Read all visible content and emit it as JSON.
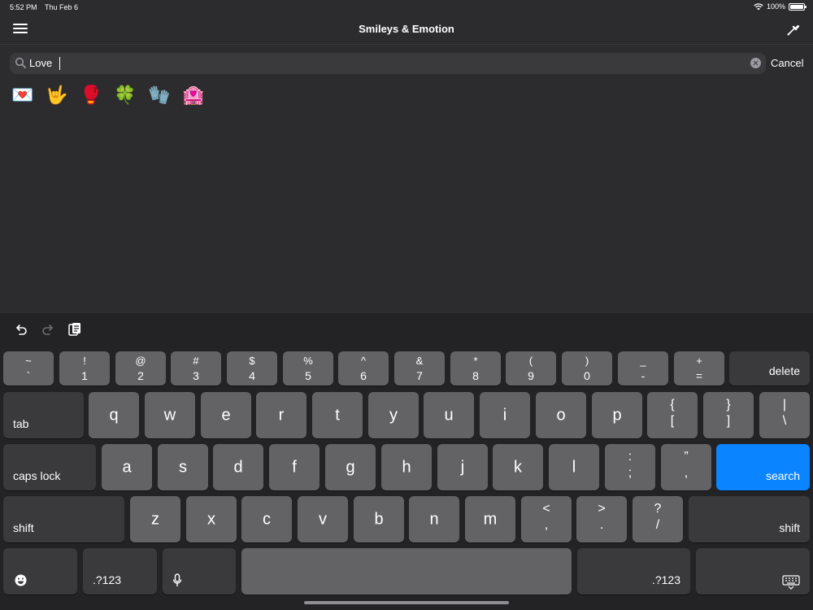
{
  "status": {
    "time": "5:52 PM",
    "date": "Thu Feb 6",
    "battery": "100%",
    "battery_level": 1.0
  },
  "nav": {
    "title": "Smileys & Emotion",
    "menu_icon": "hamburger-icon",
    "picker_icon": "eyedropper-icon"
  },
  "search": {
    "value": "Love",
    "cancel_label": "Cancel"
  },
  "results": [
    "💌",
    "🤟",
    "🥊",
    "🍀",
    "🧤",
    "🏩"
  ],
  "toolbar": {
    "undo_icon": "undo-icon",
    "redo_icon": "redo-icon",
    "paste_icon": "paste-icon"
  },
  "keyboard": {
    "row1": [
      {
        "top": "~",
        "bottom": "`"
      },
      {
        "top": "!",
        "bottom": "1"
      },
      {
        "top": "@",
        "bottom": "2"
      },
      {
        "top": "#",
        "bottom": "3"
      },
      {
        "top": "$",
        "bottom": "4"
      },
      {
        "top": "%",
        "bottom": "5"
      },
      {
        "top": "^",
        "bottom": "6"
      },
      {
        "top": "&",
        "bottom": "7"
      },
      {
        "top": "*",
        "bottom": "8"
      },
      {
        "top": "(",
        "bottom": "9"
      },
      {
        "top": ")",
        "bottom": "0"
      },
      {
        "top": "_",
        "bottom": "-"
      },
      {
        "top": "+",
        "bottom": "="
      }
    ],
    "delete_label": "delete",
    "tab_label": "tab",
    "row2": [
      "q",
      "w",
      "e",
      "r",
      "t",
      "y",
      "u",
      "i",
      "o",
      "p"
    ],
    "row2_extra": [
      {
        "top": "{",
        "bottom": "["
      },
      {
        "top": "}",
        "bottom": "]"
      },
      {
        "top": "|",
        "bottom": "\\"
      }
    ],
    "caps_label": "caps lock",
    "row3": [
      "a",
      "s",
      "d",
      "f",
      "g",
      "h",
      "j",
      "k",
      "l"
    ],
    "row3_extra": [
      {
        "top": ":",
        "bottom": ";"
      },
      {
        "top": "”",
        "bottom": ","
      }
    ],
    "search_label": "search",
    "shift_label": "shift",
    "row4": [
      "z",
      "x",
      "c",
      "v",
      "b",
      "n",
      "m"
    ],
    "row4_extra": [
      {
        "top": "<",
        "bottom": ","
      },
      {
        "top": ">",
        "bottom": "."
      },
      {
        "top": "?",
        "bottom": "/"
      }
    ],
    "numbers_label": ".?123",
    "emoji_icon": "emoji-icon",
    "mic_icon": "microphone-icon",
    "hide_icon": "keyboard-hide-icon"
  },
  "colors": {
    "background": "#2c2c2e",
    "key": "#636366",
    "key_dark": "#3a3a3c",
    "accent": "#0a84ff"
  }
}
